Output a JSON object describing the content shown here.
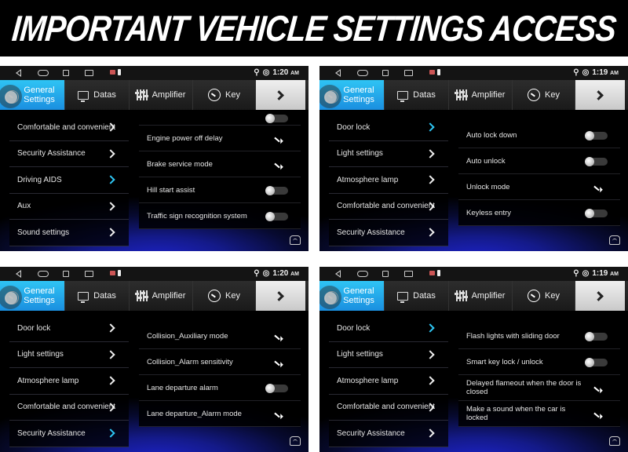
{
  "banner": {
    "title": "IMPORTANT VEHICLE SETTINGS ACCESS"
  },
  "accent_color": "#2ec7f5",
  "tabs": {
    "general": "General Settings",
    "general_line1": "General",
    "general_line2": "Settings",
    "datas": "Datas",
    "amplifier": "Amplifier",
    "key": "Key"
  },
  "panels": [
    {
      "time": "1:20",
      "time_suffix": "AM",
      "menu": [
        {
          "label": "Comfortable and convenient",
          "active": false
        },
        {
          "label": "Security Assistance",
          "active": false
        },
        {
          "label": "Driving AIDS",
          "active": true
        },
        {
          "label": "Aux",
          "active": false
        },
        {
          "label": "Sound settings",
          "active": false
        }
      ],
      "settings": [
        {
          "label": "",
          "control": "toggle",
          "partial": true
        },
        {
          "label": "Engine power off delay",
          "control": "arrow"
        },
        {
          "label": "Brake service mode",
          "control": "arrow"
        },
        {
          "label": "Hill start assist",
          "control": "toggle"
        },
        {
          "label": "Traffic sign recognition system",
          "control": "toggle"
        }
      ]
    },
    {
      "time": "1:19",
      "time_suffix": "AM",
      "menu": [
        {
          "label": "Door lock",
          "active": true
        },
        {
          "label": "Light settings",
          "active": false
        },
        {
          "label": "Atmosphere lamp",
          "active": false
        },
        {
          "label": "Comfortable and convenient",
          "active": false
        },
        {
          "label": "Security Assistance",
          "active": false
        }
      ],
      "settings": [
        {
          "label": "Auto lock down",
          "control": "toggle"
        },
        {
          "label": "Auto unlock",
          "control": "toggle"
        },
        {
          "label": "Unlock mode",
          "control": "arrow"
        },
        {
          "label": "Keyless entry",
          "control": "toggle"
        }
      ]
    },
    {
      "time": "1:20",
      "time_suffix": "AM",
      "menu": [
        {
          "label": "Door lock",
          "active": false
        },
        {
          "label": "Light settings",
          "active": false
        },
        {
          "label": "Atmosphere lamp",
          "active": false
        },
        {
          "label": "Comfortable and convenient",
          "active": false
        },
        {
          "label": "Security Assistance",
          "active": true
        }
      ],
      "settings": [
        {
          "label": "Collision_Auxiliary mode",
          "control": "arrow"
        },
        {
          "label": "Collision_Alarm sensitivity",
          "control": "arrow"
        },
        {
          "label": "Lane departure alarm",
          "control": "toggle"
        },
        {
          "label": "Lane departure_Alarm mode",
          "control": "arrow"
        }
      ]
    },
    {
      "time": "1:19",
      "time_suffix": "AM",
      "menu": [
        {
          "label": "Door lock",
          "active": true
        },
        {
          "label": "Light settings",
          "active": false
        },
        {
          "label": "Atmosphere lamp",
          "active": false
        },
        {
          "label": "Comfortable and convenient",
          "active": false
        },
        {
          "label": "Security Assistance",
          "active": false
        }
      ],
      "settings": [
        {
          "label": "Flash lights with sliding door",
          "control": "toggle"
        },
        {
          "label": "Smart key lock / unlock",
          "control": "toggle"
        },
        {
          "label": "Delayed flameout when the door is closed",
          "control": "arrow"
        },
        {
          "label": "Make a sound when the car is locked",
          "control": "arrow"
        }
      ]
    }
  ]
}
